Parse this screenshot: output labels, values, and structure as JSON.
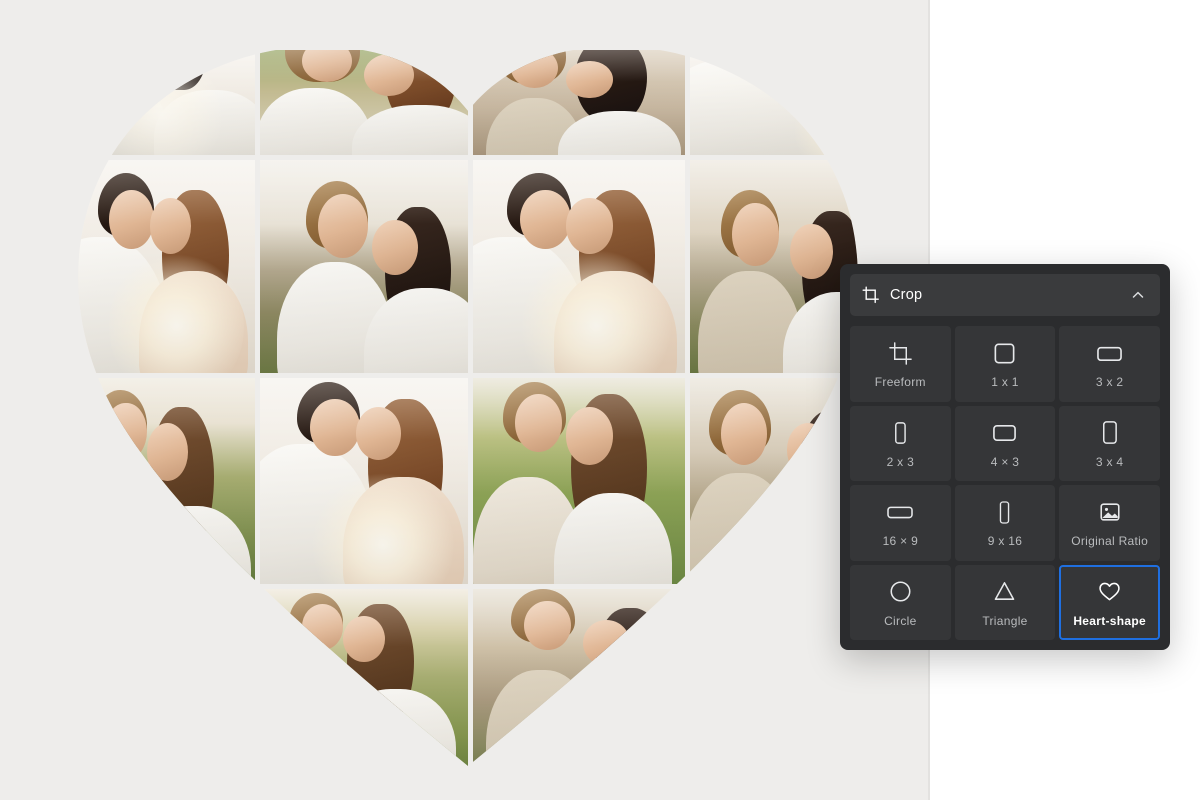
{
  "canvas": {
    "background_color": "#eeedeb",
    "right_background_color": "#ffffff",
    "collage": {
      "shape": "heart",
      "grid_columns": 4,
      "grid_rows": 4,
      "tiles": [
        {
          "id": "r1c1",
          "subject": "couple embracing, white outfits, close crop"
        },
        {
          "id": "r1c2",
          "subject": "man in white polo kissing woman's forehead"
        },
        {
          "id": "r1c3",
          "subject": "man kissing dark-haired woman, desert field"
        },
        {
          "id": "r1c4",
          "subject": "white shirt sleeve with sun flare"
        },
        {
          "id": "r2c1",
          "subject": "couple foreheads together, backlit sun flare"
        },
        {
          "id": "r2c2",
          "subject": "blond man kissing dark-haired woman, prairie"
        },
        {
          "id": "r2c3",
          "subject": "couple foreheads together, backlit sun flare"
        },
        {
          "id": "r2c4",
          "subject": "couple kissing in tall grass, suspenders"
        },
        {
          "id": "r3c1",
          "subject": "man kissing woman's head in green field"
        },
        {
          "id": "r3c2",
          "subject": "couple embracing, strong sun flare"
        },
        {
          "id": "r3c3",
          "subject": "man kissing woman's temple in tall grass"
        },
        {
          "id": "r3c4",
          "subject": "couple kissing, dune background"
        },
        {
          "id": "r4c2",
          "subject": "man kissing woman's head in green field"
        },
        {
          "id": "r4c3",
          "subject": "couple kissing, dune background"
        }
      ]
    }
  },
  "crop_panel": {
    "title": "Crop",
    "header_icon": "crop-icon",
    "collapse_icon": "chevron-up-icon",
    "panel_color": "#2b2c2e",
    "header_color": "#3a3b3d",
    "cell_color": "#353638",
    "accent_color": "#1f6fe0",
    "selected_option": "Heart-shape",
    "options": [
      {
        "label": "Freeform",
        "icon": "freeform-crop-icon",
        "selected": false
      },
      {
        "label": "1 x 1",
        "icon": "square-icon",
        "selected": false
      },
      {
        "label": "3 x 2",
        "icon": "landscape-3-2-icon",
        "selected": false
      },
      {
        "label": "2 x 3",
        "icon": "portrait-2-3-icon",
        "selected": false
      },
      {
        "label": "4 × 3",
        "icon": "landscape-4-3-icon",
        "selected": false
      },
      {
        "label": "3 x 4",
        "icon": "portrait-3-4-icon",
        "selected": false
      },
      {
        "label": "16 × 9",
        "icon": "landscape-16-9-icon",
        "selected": false
      },
      {
        "label": "9 x 16",
        "icon": "portrait-9-16-icon",
        "selected": false
      },
      {
        "label": "Original Ratio",
        "icon": "image-icon",
        "selected": false
      },
      {
        "label": "Circle",
        "icon": "circle-icon",
        "selected": false
      },
      {
        "label": "Triangle",
        "icon": "triangle-icon",
        "selected": false
      },
      {
        "label": "Heart-shape",
        "icon": "heart-icon",
        "selected": true
      }
    ]
  }
}
